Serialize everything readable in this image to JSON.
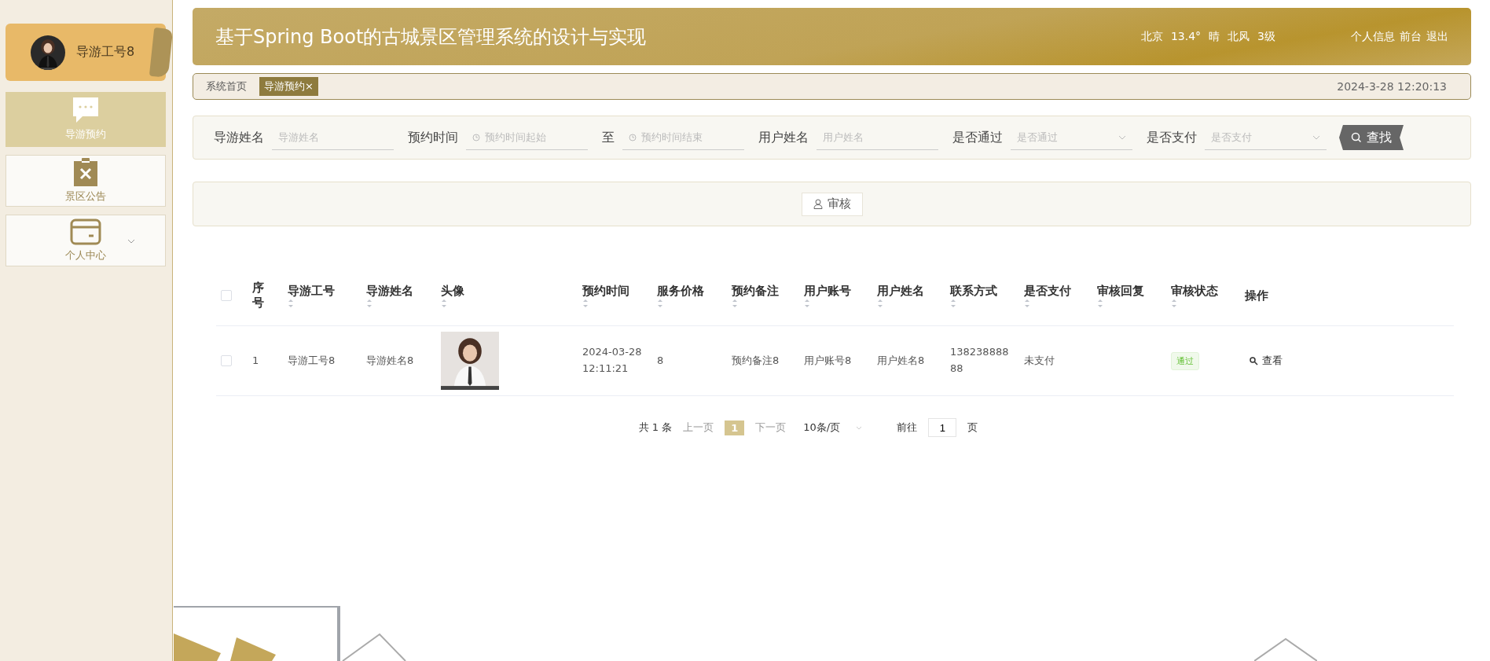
{
  "sidebar": {
    "user": {
      "name": "导游工号8",
      "avatar": {
        "kind": "picture"
      }
    },
    "items": [
      {
        "label": "导游预约",
        "kind": "chat",
        "selected": true
      },
      {
        "label": "景区公告",
        "kind": "clipboard",
        "selected": false
      },
      {
        "label": "个人中心",
        "kind": "card",
        "selected": false,
        "expanded": false
      }
    ]
  },
  "header": {
    "title": "基于Spring Boot的古城景区管理系统的设计与实现",
    "weather": [
      "北京",
      "13.4°",
      "晴",
      "北风",
      "3级"
    ],
    "links": [
      "个人信息",
      "前台",
      "退出"
    ]
  },
  "tabs": {
    "items": [
      {
        "label": "系统首页",
        "selected": false
      },
      {
        "label": "导游预约",
        "close": "×",
        "selected": true
      }
    ],
    "datetime": "2024-3-28 12:20:13"
  },
  "search": {
    "fields": [
      {
        "label": "导游姓名",
        "kind": "text",
        "placeholder": "导游姓名"
      },
      {
        "label": "预约时间",
        "kind": "date",
        "placeholder": "预约时间起始"
      },
      {
        "label": "至",
        "kind": "date",
        "placeholder": "预约时间结束"
      },
      {
        "label": "用户姓名",
        "kind": "text",
        "placeholder": "用户姓名"
      },
      {
        "label": "是否通过",
        "kind": "select",
        "placeholder": "是否通过"
      },
      {
        "label": "是否支付",
        "kind": "select",
        "placeholder": "是否支付"
      }
    ],
    "button": "查找"
  },
  "actions": [
    "审核"
  ],
  "table": {
    "all_checked": false,
    "columns": [
      {
        "label": "序号",
        "sortable": false
      },
      {
        "label": "导游工号",
        "sortable": true
      },
      {
        "label": "导游姓名",
        "sortable": true
      },
      {
        "label": "头像",
        "sortable": true
      },
      {
        "label": "预约时间",
        "sortable": true
      },
      {
        "label": "服务价格",
        "sortable": true
      },
      {
        "label": "预约备注",
        "sortable": true
      },
      {
        "label": "用户账号",
        "sortable": true
      },
      {
        "label": "用户姓名",
        "sortable": true
      },
      {
        "label": "联系方式",
        "sortable": true
      },
      {
        "label": "是否支付",
        "sortable": true
      },
      {
        "label": "审核回复",
        "sortable": true
      },
      {
        "label": "审核状态",
        "sortable": true
      },
      {
        "label": "操作",
        "sortable": false
      }
    ],
    "rows": [
      {
        "checked": false,
        "cells": [
          {
            "kind": "text",
            "text": "1"
          },
          {
            "kind": "text",
            "text": "导游工号8"
          },
          {
            "kind": "text",
            "text": "导游姓名8"
          },
          {
            "kind": "picture"
          },
          {
            "kind": "text",
            "text": "2024-03-28 12:11:21"
          },
          {
            "kind": "text",
            "text": "8"
          },
          {
            "kind": "text",
            "text": "预约备注8"
          },
          {
            "kind": "text",
            "text": "用户账号8"
          },
          {
            "kind": "text",
            "text": "用户姓名8"
          },
          {
            "kind": "text",
            "text": "13823888888"
          },
          {
            "kind": "text",
            "text": "未支付"
          },
          {
            "kind": "empty"
          },
          {
            "kind": "tag",
            "text": "通过"
          },
          {
            "kind": "action",
            "text": "查看"
          }
        ]
      }
    ]
  },
  "pagination": {
    "total": "共 1 条",
    "prev": "上一页",
    "pages": [
      {
        "label": "1",
        "selected": true
      }
    ],
    "next": "下一页",
    "size": "10条/页",
    "goto": "前往",
    "goto_value": "1",
    "goto_suffix": "页"
  }
}
